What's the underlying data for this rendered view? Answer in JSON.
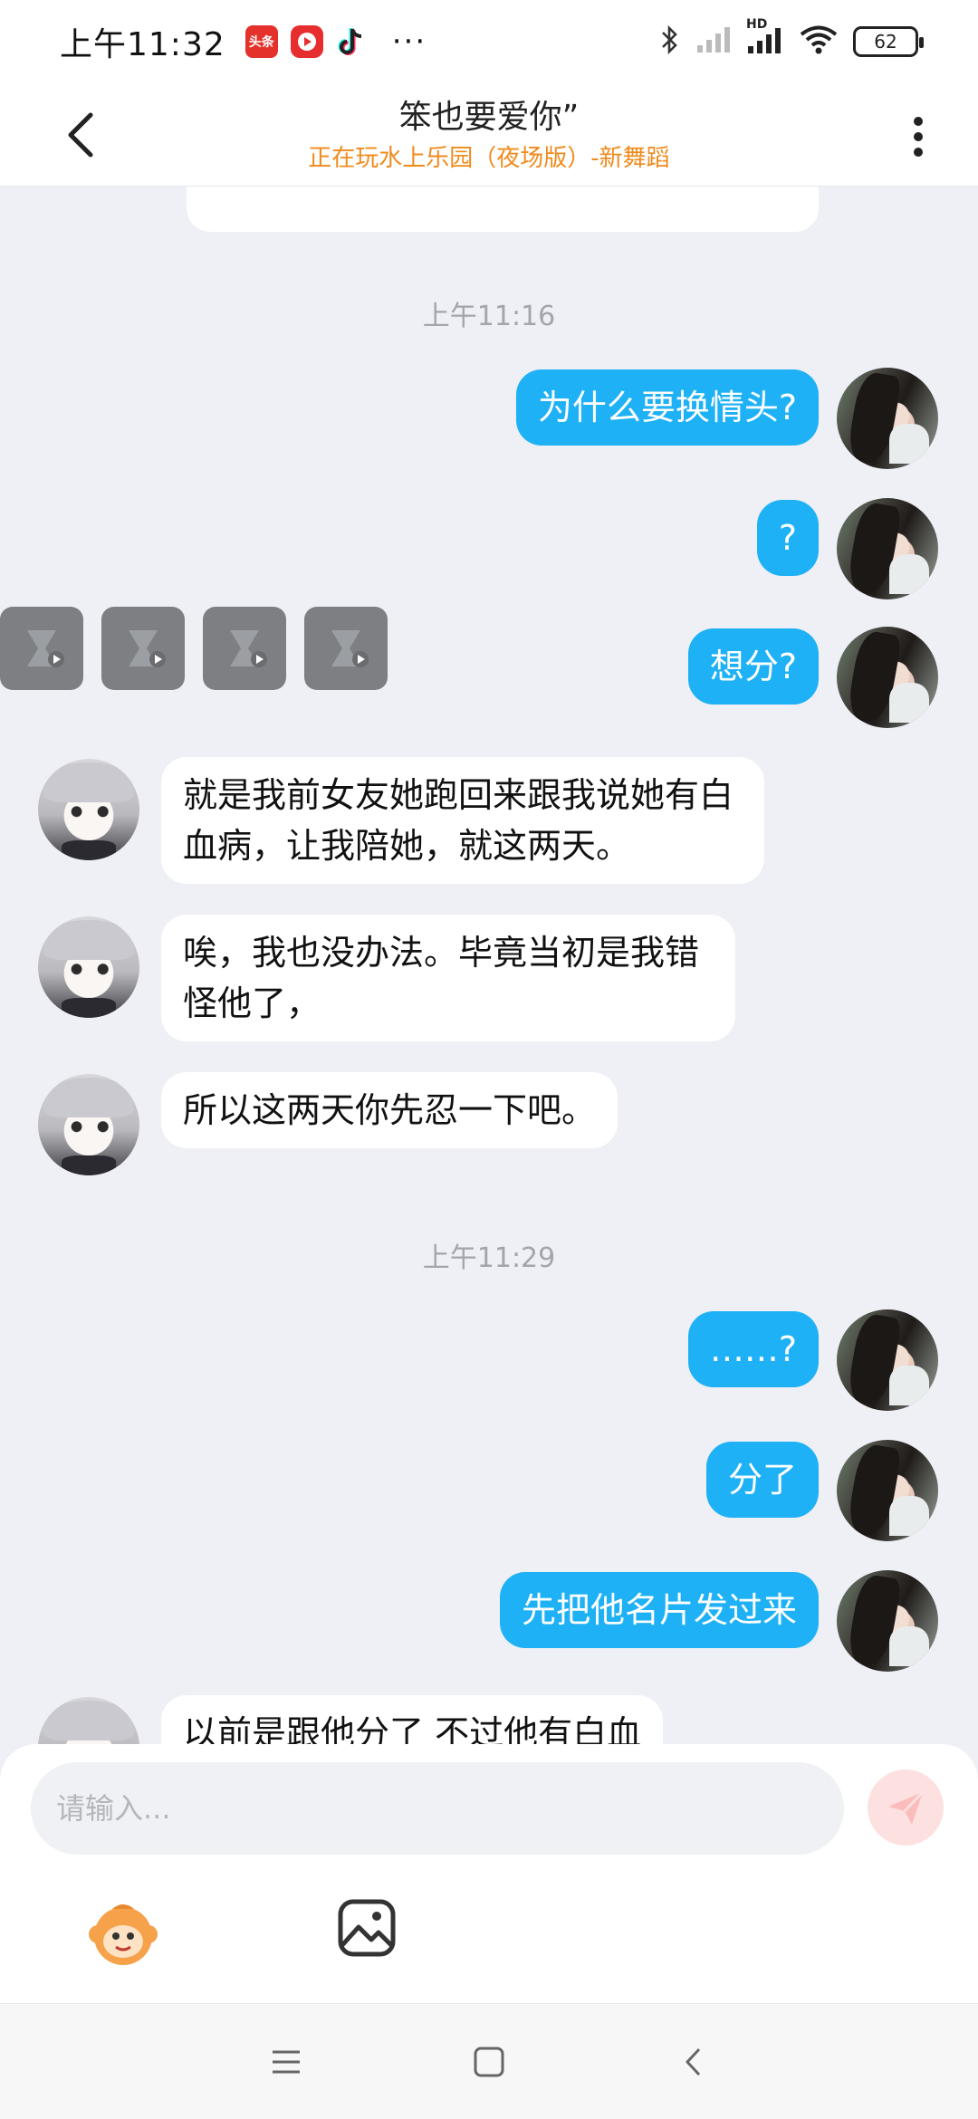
{
  "status_bar": {
    "time": "上午11:32",
    "apps": [
      "toutiao-icon",
      "video-app-icon",
      "tiktok-icon"
    ],
    "more": "···",
    "network_label": "HD",
    "battery": "62"
  },
  "header": {
    "title": "笨也要爱你”",
    "subtitle": "正在玩水上乐园（夜场版）-新舞蹈"
  },
  "messages": {
    "time_1": "上午11:16",
    "out_1": "为什么要换情头?",
    "out_2": "?",
    "out_3": "想分?",
    "in_1": "就是我前女友她跑回来跟我说她有白血病，让我陪她，就这两天。",
    "in_2": "唉，我也没办法。毕竟当初是我错怪他了，",
    "in_3": "所以这两天你先忍一下吧。",
    "time_2": "上午11:29",
    "out_4": "……?",
    "out_5": "分了",
    "out_6": "先把他名片发过来",
    "in_4_partial": "以前是跟他分了 不过他有白血"
  },
  "input": {
    "placeholder": "请输入..."
  },
  "colors": {
    "outgoing_bubble": "#1eb1f6",
    "incoming_bubble": "#ffffff",
    "background": "#eef0f6",
    "subtitle": "#f08a1c"
  }
}
